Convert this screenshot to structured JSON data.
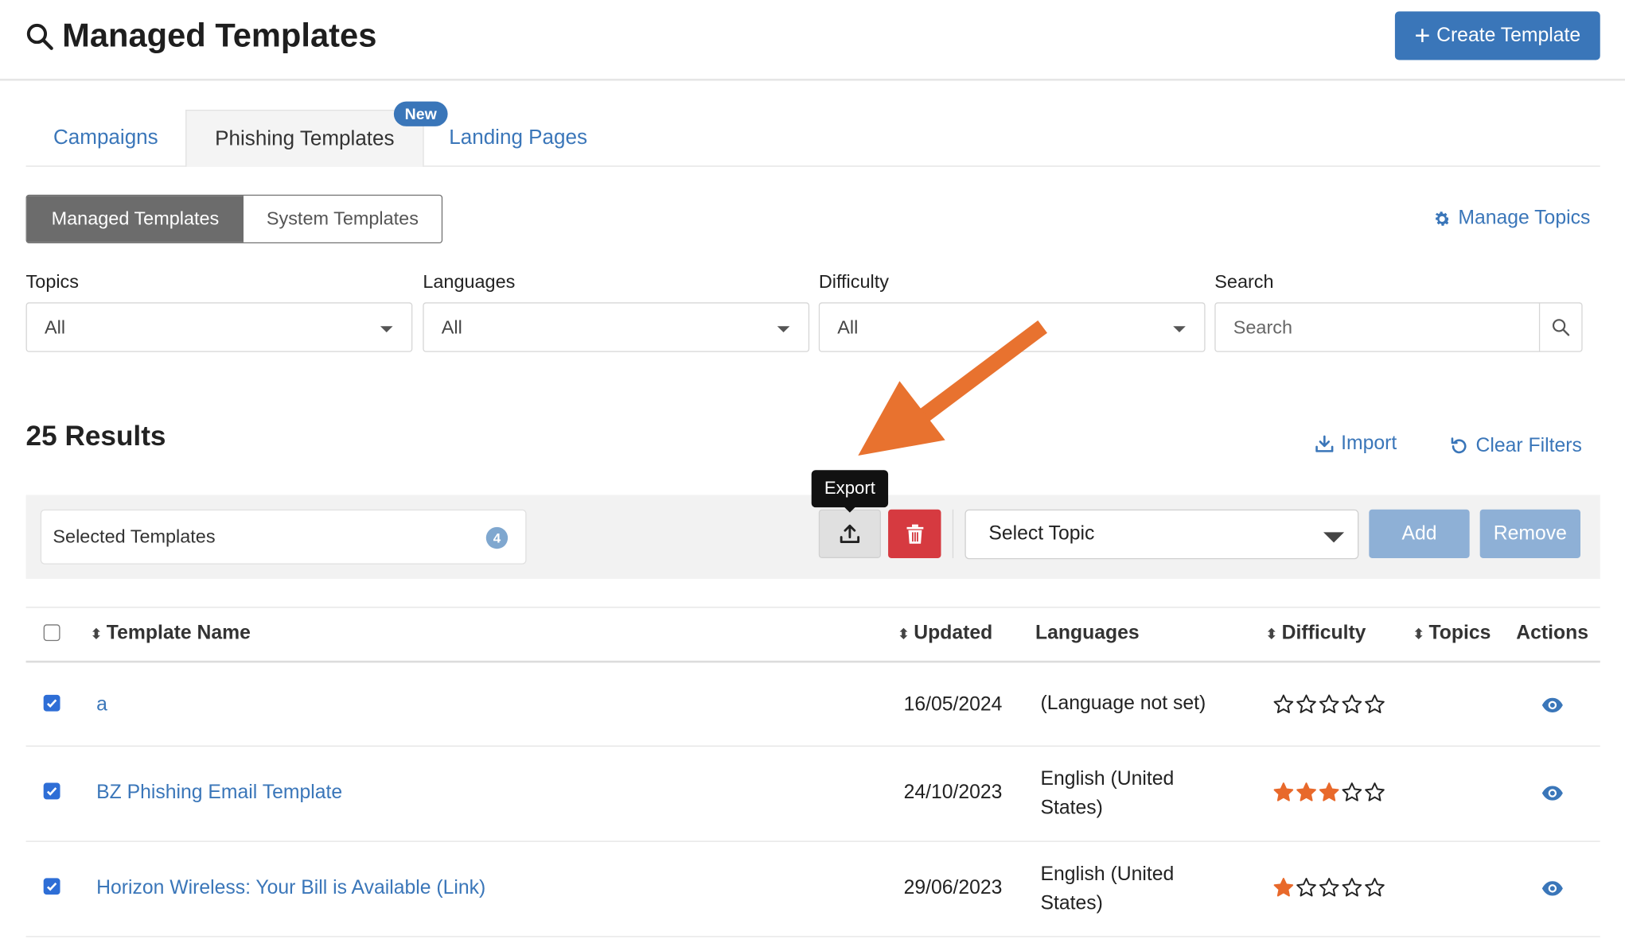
{
  "header": {
    "title": "Managed Templates",
    "create_button": "Create Template"
  },
  "tabs": {
    "campaigns": "Campaigns",
    "phishing_templates": "Phishing Templates",
    "landing_pages": "Landing Pages",
    "new_badge": "New",
    "active": "Phishing Templates"
  },
  "segment": {
    "managed": "Managed Templates",
    "system": "System Templates",
    "active": "Managed Templates"
  },
  "manage_topics": "Manage Topics",
  "filters": {
    "topics": {
      "label": "Topics",
      "value": "All"
    },
    "languages": {
      "label": "Languages",
      "value": "All"
    },
    "difficulty": {
      "label": "Difficulty",
      "value": "All"
    },
    "search": {
      "label": "Search",
      "placeholder": "Search"
    }
  },
  "results_text": "25 Results",
  "actions": {
    "import": "Import",
    "clear_filters": "Clear Filters"
  },
  "toolbar": {
    "selected_label": "Selected Templates",
    "selected_count": "4",
    "export_tooltip": "Export",
    "topic_select": "Select Topic",
    "add": "Add",
    "remove": "Remove"
  },
  "table": {
    "headers": {
      "name": "Template Name",
      "updated": "Updated",
      "languages": "Languages",
      "difficulty": "Difficulty",
      "topics": "Topics",
      "actions": "Actions"
    },
    "rows": [
      {
        "checked": true,
        "name": "a",
        "updated": "16/05/2024",
        "language": "(Language not set)",
        "difficulty": 0
      },
      {
        "checked": true,
        "name": "BZ Phishing Email Template",
        "updated": "24/10/2023",
        "language": "English (United States)",
        "difficulty": 3
      },
      {
        "checked": true,
        "name": "Horizon Wireless: Your Bill is Available (Link)",
        "updated": "29/06/2023",
        "language": "English (United States)",
        "difficulty": 1
      }
    ]
  },
  "colors": {
    "primary": "#3a76b9",
    "danger": "#d63a40",
    "star_filled": "#e8692b",
    "annotation_arrow": "#e8722f"
  }
}
